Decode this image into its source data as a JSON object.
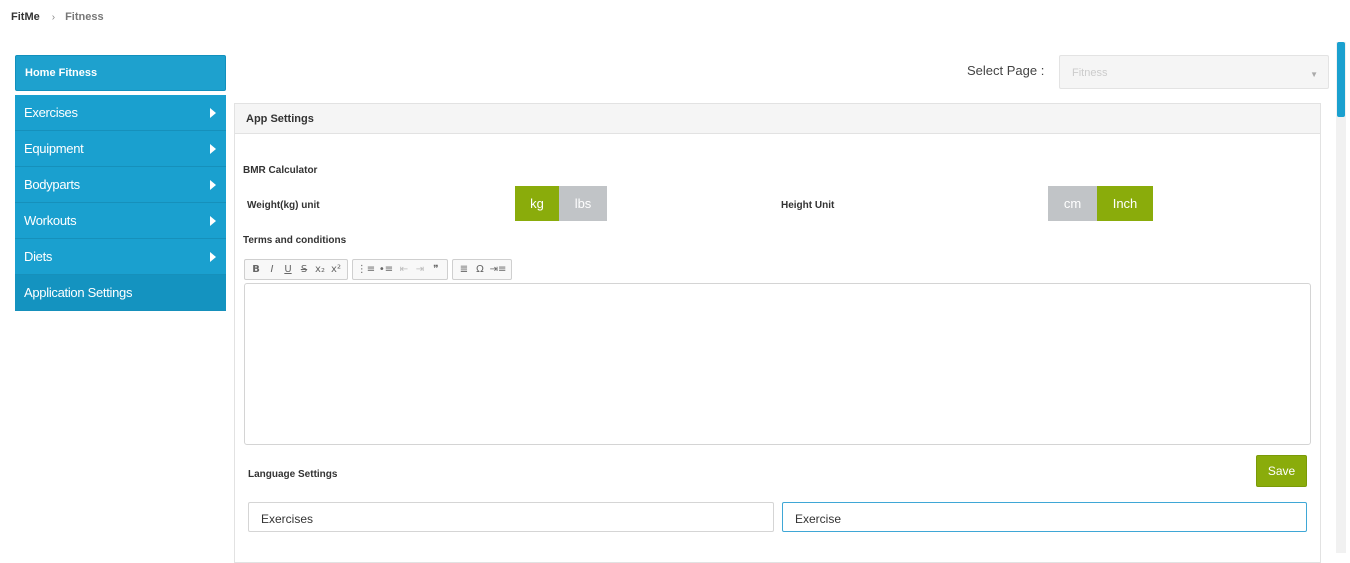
{
  "breadcrumb": {
    "home": "FitMe",
    "separator": "›",
    "current": "Fitness"
  },
  "sidebar": {
    "header": "Home Fitness",
    "items": [
      {
        "label": "Exercises",
        "has_arrow": true
      },
      {
        "label": "Equipment",
        "has_arrow": true
      },
      {
        "label": "Bodyparts",
        "has_arrow": true
      },
      {
        "label": "Workouts",
        "has_arrow": true
      },
      {
        "label": "Diets",
        "has_arrow": true
      },
      {
        "label": "Application Settings",
        "has_arrow": false
      }
    ]
  },
  "select_page": {
    "label": "Select Page :",
    "value": "Fitness",
    "caret": "▼"
  },
  "panel": {
    "title": "App Settings",
    "bmr": {
      "title": "BMR Calculator",
      "weight_label": "Weight(kg) unit",
      "weight_options": [
        "kg",
        "lbs"
      ],
      "weight_selected": "kg",
      "height_label": "Height Unit",
      "height_options": [
        "cm",
        "Inch"
      ],
      "height_selected": "Inch"
    },
    "terms": {
      "title": "Terms and conditions",
      "toolbar_icons": [
        "bold-icon",
        "italic-icon",
        "underline-icon",
        "strikethrough-icon",
        "subscript-icon",
        "superscript-icon",
        "numbered-list-icon",
        "bullet-list-icon",
        "outdent-icon",
        "indent-icon",
        "blockquote-icon",
        "align-icon",
        "special-char-icon",
        "more-icon"
      ],
      "toolbar_glyphs": {
        "b": "B",
        "i": "I",
        "u": "U",
        "s": "S",
        "sub": "x₂",
        "sup": "x²",
        "ol": "⋮≡",
        "ul": "•≡",
        "outdent": "⇤",
        "indent": "⇥",
        "quote": "❞",
        "align": "≣",
        "omega": "Ω",
        "more": "⇥≡"
      },
      "content": ""
    },
    "save_label": "Save",
    "language": {
      "title": "Language Settings",
      "key": "Exercises",
      "value": "Exercise"
    }
  },
  "colors": {
    "accent_blue": "#1aa0cf",
    "accent_green": "#8aac0b",
    "toggle_off": "#c1c4c7"
  }
}
